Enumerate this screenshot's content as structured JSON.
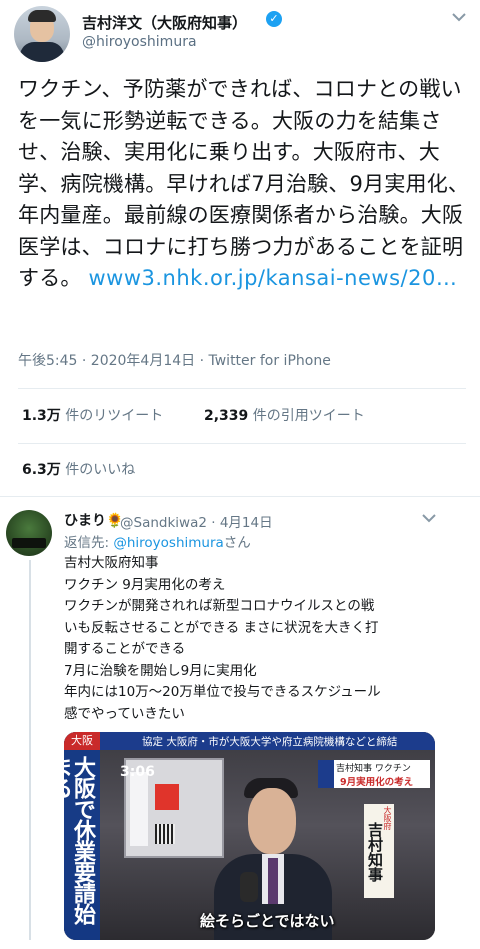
{
  "author": {
    "name": "吉村洋文（大阪府知事）",
    "handle": "@hiroyoshimura",
    "verified": true
  },
  "tweet": {
    "text": "ワクチン、予防薬ができれば、コロナとの戦いを一気に形勢逆転できる。大阪の力を結集させ、治験、実用化に乗り出す。大阪府市、大学、病院機構。早ければ7月治験、9月実用化、年内量産。最前線の医療関係者から治験。大阪医学は、コロナに打ち勝つ力があることを証明する。",
    "link": "www3.nhk.or.jp/kansai-news/20…",
    "time": "午後5:45 · 2020年4月14日 · Twitter for iPhone"
  },
  "stats": {
    "retweets_count": "1.3万",
    "retweets_label": " 件のリツイート",
    "quotes_count": "2,339",
    "quotes_label": " 件の引用ツイート",
    "likes_count": "6.3万",
    "likes_label": " 件のいいね"
  },
  "reply": {
    "name": "ひまり🌻",
    "handle_date": "@Sandkiwa2 · 4月14日",
    "reply_prefix": "返信先: ",
    "reply_to": "@hiroyoshimura",
    "reply_suffix": "さん",
    "lines": [
      "吉村大阪府知事",
      "ワクチン 9月実用化の考え",
      "ワクチンが開発されれば新型コロナウイルスとの戦",
      "いも反転させることができる まさに状況を大きく打",
      "開することができる",
      "7月に治験を開始し9月に実用化",
      "年内には10万～20万単位で投与できるスケジュール",
      "感でやっていきたい"
    ]
  },
  "video": {
    "corner_tag": "大阪",
    "banner": "協定 大阪府・市が大阪大学や府立病院機構などと締結",
    "clock": "3:06",
    "vertical_caption": "大阪で休業要請始まる",
    "headline_small": "吉村知事",
    "headline_main": "ワクチン",
    "headline_sub": "9月実用化の考え",
    "nameplate_office": "大阪府",
    "nameplate_name": "吉村知事",
    "subtitle": "絵そらごとではない"
  },
  "icons": {
    "verified": "verified-check-icon",
    "more": "chevron-down-icon"
  },
  "colors": {
    "link": "#1b95e0",
    "verified": "#1da1f2",
    "nhk_banner": "#1c3c8c"
  }
}
